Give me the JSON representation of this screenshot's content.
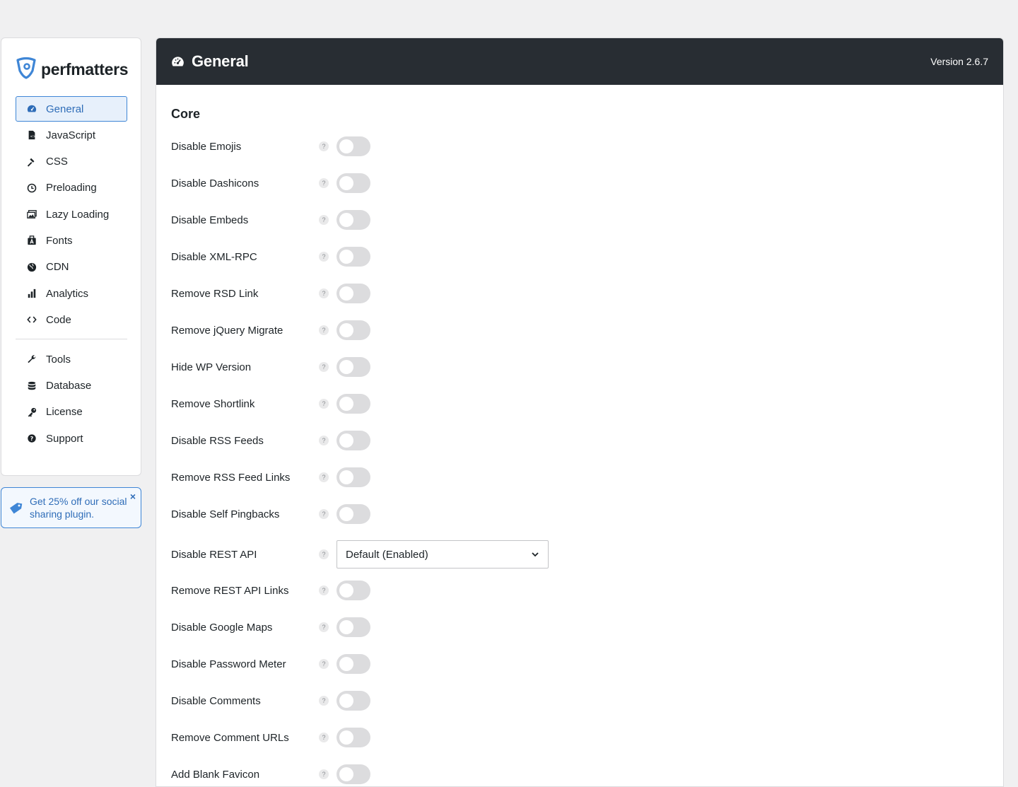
{
  "brand": {
    "name": "perfmatters",
    "accent": "#3f86d6"
  },
  "sidebar": {
    "items": [
      {
        "label": "General",
        "icon": "dashboard-icon",
        "active": true
      },
      {
        "label": "JavaScript",
        "icon": "js-file-icon"
      },
      {
        "label": "CSS",
        "icon": "hammer-icon"
      },
      {
        "label": "Preloading",
        "icon": "clock-icon"
      },
      {
        "label": "Lazy Loading",
        "icon": "images-icon"
      },
      {
        "label": "Fonts",
        "icon": "fonts-icon"
      },
      {
        "label": "CDN",
        "icon": "globe-icon"
      },
      {
        "label": "Analytics",
        "icon": "bar-chart-icon"
      },
      {
        "label": "Code",
        "icon": "code-icon"
      }
    ],
    "secondary_items": [
      {
        "label": "Tools",
        "icon": "wrench-icon"
      },
      {
        "label": "Database",
        "icon": "database-icon"
      },
      {
        "label": "License",
        "icon": "key-icon"
      },
      {
        "label": "Support",
        "icon": "question-circle-icon"
      }
    ]
  },
  "promo": {
    "text": "Get 25% off our social sharing plugin.",
    "close": "×",
    "icon": "tag-icon"
  },
  "header": {
    "title": "General",
    "version": "Version 2.6.7",
    "icon": "dashboard-icon"
  },
  "section": {
    "title": "Core"
  },
  "help_glyph": "?",
  "settings": [
    {
      "label": "Disable Emojis",
      "type": "toggle",
      "on": false
    },
    {
      "label": "Disable Dashicons",
      "type": "toggle",
      "on": false
    },
    {
      "label": "Disable Embeds",
      "type": "toggle",
      "on": false
    },
    {
      "label": "Disable XML-RPC",
      "type": "toggle",
      "on": false
    },
    {
      "label": "Remove RSD Link",
      "type": "toggle",
      "on": false
    },
    {
      "label": "Remove jQuery Migrate",
      "type": "toggle",
      "on": false
    },
    {
      "label": "Hide WP Version",
      "type": "toggle",
      "on": false
    },
    {
      "label": "Remove Shortlink",
      "type": "toggle",
      "on": false
    },
    {
      "label": "Disable RSS Feeds",
      "type": "toggle",
      "on": false
    },
    {
      "label": "Remove RSS Feed Links",
      "type": "toggle",
      "on": false
    },
    {
      "label": "Disable Self Pingbacks",
      "type": "toggle",
      "on": false
    },
    {
      "label": "Disable REST API",
      "type": "select",
      "value": "Default (Enabled)"
    },
    {
      "label": "Remove REST API Links",
      "type": "toggle",
      "on": false
    },
    {
      "label": "Disable Google Maps",
      "type": "toggle",
      "on": false
    },
    {
      "label": "Disable Password Meter",
      "type": "toggle",
      "on": false
    },
    {
      "label": "Disable Comments",
      "type": "toggle",
      "on": false
    },
    {
      "label": "Remove Comment URLs",
      "type": "toggle",
      "on": false
    },
    {
      "label": "Add Blank Favicon",
      "type": "toggle",
      "on": false
    }
  ]
}
